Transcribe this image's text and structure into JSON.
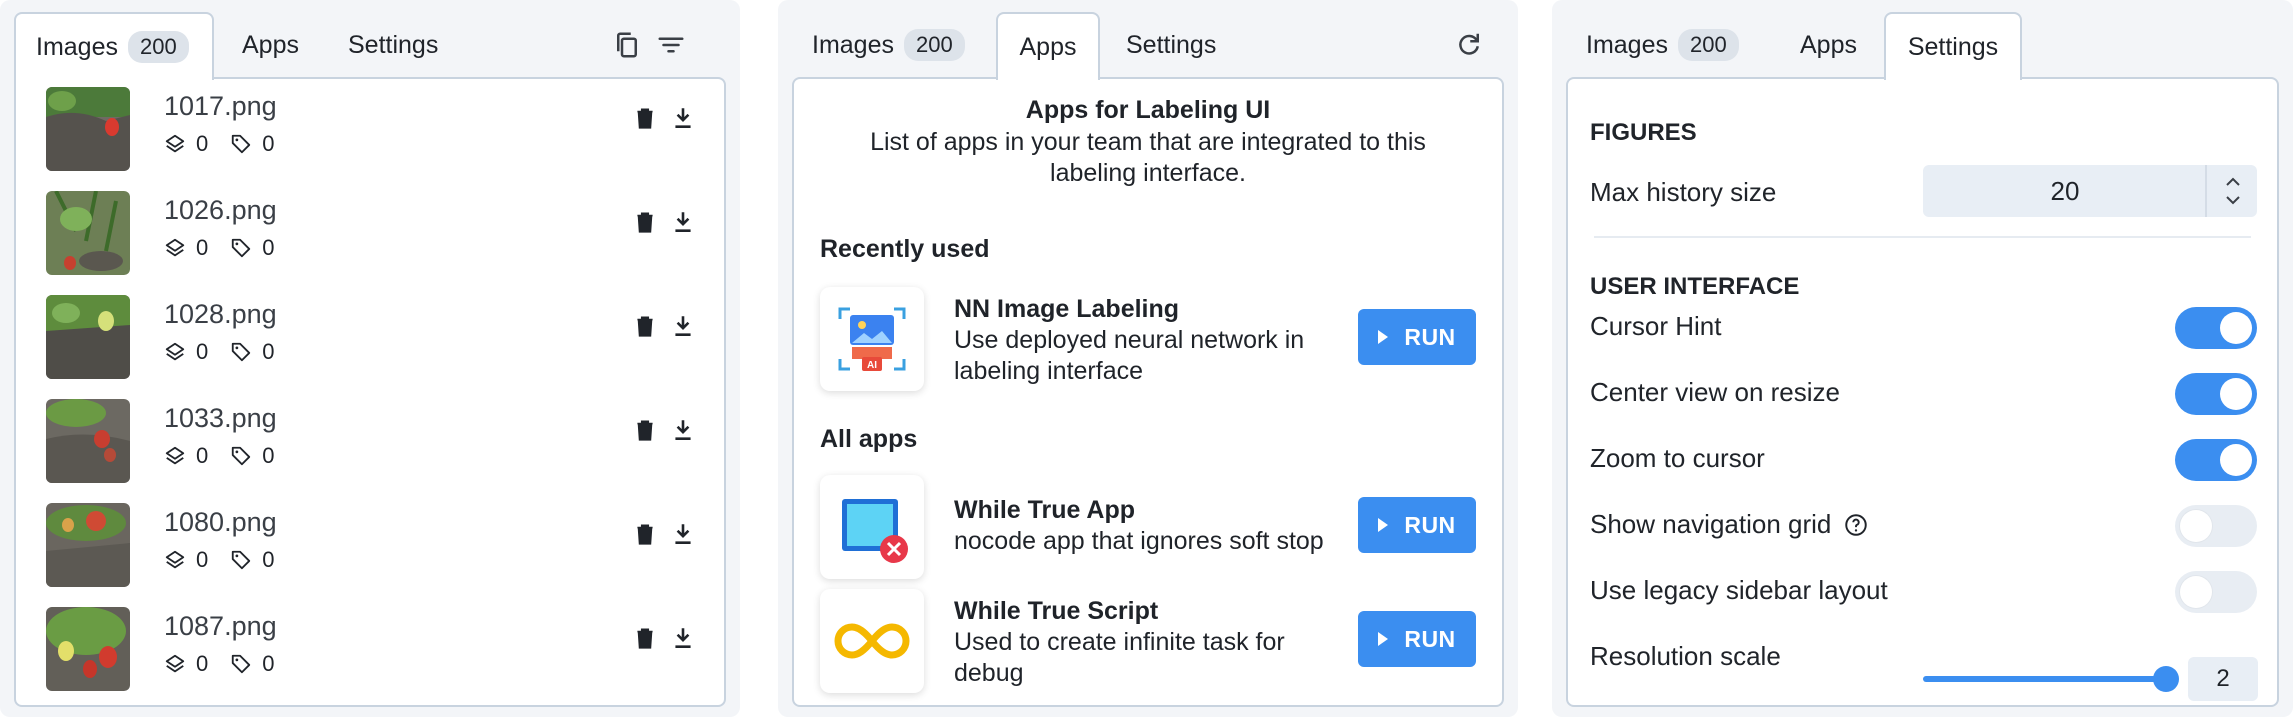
{
  "images_panel": {
    "tabs": [
      {
        "label": "Images",
        "badge": "200"
      },
      {
        "label": "Apps"
      },
      {
        "label": "Settings"
      }
    ],
    "rows": [
      {
        "name": "1017.png",
        "figures": "0",
        "tags": "0"
      },
      {
        "name": "1026.png",
        "figures": "0",
        "tags": "0"
      },
      {
        "name": "1028.png",
        "figures": "0",
        "tags": "0"
      },
      {
        "name": "1033.png",
        "figures": "0",
        "tags": "0"
      },
      {
        "name": "1080.png",
        "figures": "0",
        "tags": "0"
      },
      {
        "name": "1087.png",
        "figures": "0",
        "tags": "0"
      }
    ]
  },
  "apps_panel": {
    "tabs": [
      {
        "label": "Images",
        "badge": "200"
      },
      {
        "label": "Apps"
      },
      {
        "label": "Settings"
      }
    ],
    "title": "Apps for Labeling UI",
    "description": "List of apps in your team that are integrated to this labeling interface.",
    "recent_heading": "Recently used",
    "all_heading": "All apps",
    "recent": [
      {
        "name": "NN Image Labeling",
        "description": "Use deployed neural network in labeling interface",
        "icon_text": "AI",
        "run_label": "RUN"
      }
    ],
    "all": [
      {
        "name": "While True App",
        "description": "nocode app that ignores soft stop",
        "run_label": "RUN"
      },
      {
        "name": "While True Script",
        "description": "Used to create infinite task for debug",
        "run_label": "RUN"
      }
    ]
  },
  "settings_panel": {
    "tabs": [
      {
        "label": "Images",
        "badge": "200"
      },
      {
        "label": "Apps"
      },
      {
        "label": "Settings"
      }
    ],
    "figures_heading": "FIGURES",
    "max_history_label": "Max history size",
    "max_history_value": "20",
    "ui_heading": "USER INTERFACE",
    "toggles": [
      {
        "label": "Cursor Hint",
        "on": true
      },
      {
        "label": "Center view on resize",
        "on": true
      },
      {
        "label": "Zoom to cursor",
        "on": true
      },
      {
        "label": "Show navigation grid",
        "on": false
      },
      {
        "label": "Use legacy sidebar layout",
        "on": false
      }
    ],
    "resolution_label": "Resolution scale",
    "resolution_value": "2",
    "resolution_fraction": 1.0
  },
  "colors": {
    "accent": "#3b8ef0",
    "badge_bg": "#dde3ea",
    "panel_bg": "#f3f5f8",
    "border": "#c8d3df"
  }
}
